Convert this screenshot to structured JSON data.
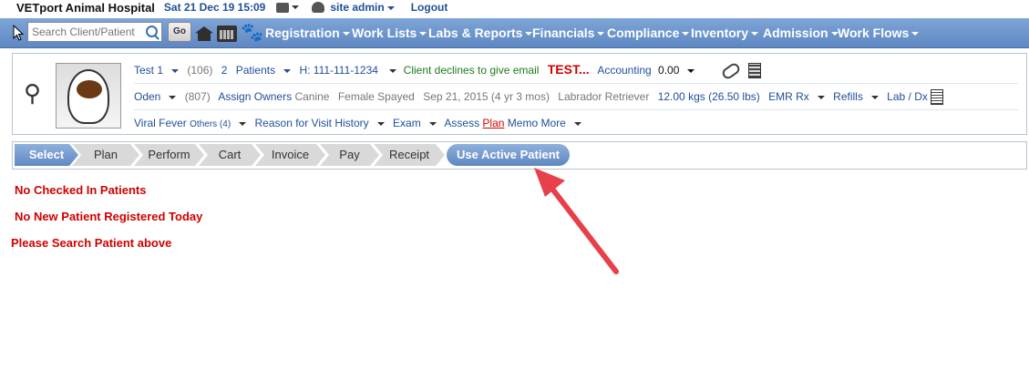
{
  "topbar": {
    "hospital": "VETport Animal Hospital",
    "datetime": "Sat 21 Dec 19 15:09",
    "user": "site admin",
    "logout": "Logout"
  },
  "nav": {
    "search_placeholder": "Search Client/Patient",
    "go": "Go",
    "menus": [
      "Registration",
      "Work Lists",
      "Labs & Reports",
      "Financials",
      "Compliance",
      "Inventory",
      "Admission",
      "Work Flows"
    ]
  },
  "patient": {
    "client_name": "Test 1",
    "client_id": "(106)",
    "patients_count": "2",
    "patients_label": "Patients",
    "phone": "H: 111-111-1234",
    "email_note": "Client declines to give email",
    "alert": "TEST...",
    "accounting_label": "Accounting",
    "accounting_value": "0.00",
    "pet_name": "Oden",
    "pet_id": "(807)",
    "assign_owners": "Assign Owners",
    "species": "Canine",
    "sex": "Female Spayed",
    "dob": "Sep 21, 2015 (4 yr 3 mos)",
    "breed": "Labrador Retriever",
    "weight": "12.00 kgs (26.50 lbs)",
    "emr": "EMR",
    "rx": "Rx",
    "refills": "Refills",
    "lab_dx": "Lab / Dx",
    "problem": "Viral Fever",
    "others": "Others (4)",
    "reason": "Reason for Visit",
    "history": "History",
    "exam": "Exam",
    "assess": "Assess",
    "plan": "Plan",
    "memo": "Memo",
    "more": "More"
  },
  "steps": {
    "items": [
      "Select",
      "Plan",
      "Perform",
      "Cart",
      "Invoice",
      "Pay",
      "Receipt"
    ],
    "use_active": "Use Active Patient"
  },
  "messages": {
    "no_checked_in": "No Checked In Patients",
    "no_new": "No New Patient Registered Today",
    "search_hint": "Please Search Patient above"
  },
  "colors": {
    "nav_bg": "#6f97cd",
    "link": "#1f4f9a",
    "alert": "#d10000",
    "arrow": "#e8404a"
  }
}
